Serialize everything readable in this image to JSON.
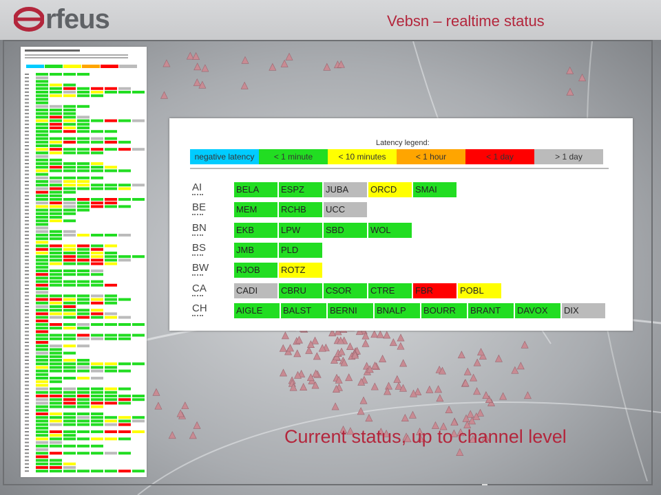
{
  "header": {
    "logo_text": "rfeus",
    "title": "Vebsn – realtime status"
  },
  "colors": {
    "negative": "#00ccff",
    "lt1min": "#22dd22",
    "lt10min": "#ffff00",
    "lt1hour": "#ffa500",
    "lt1day": "#ff0000",
    "gt1day": "#bbbbbb",
    "accent": "#b3263c",
    "marker": "#c88b93"
  },
  "legend": {
    "title": "Latency legend:",
    "items": [
      {
        "label": "negative latency",
        "status": "negative"
      },
      {
        "label": "< 1 minute",
        "status": "lt1min"
      },
      {
        "label": "< 10 minutes",
        "status": "lt10min"
      },
      {
        "label": "< 1 hour",
        "status": "lt1hour"
      },
      {
        "label": "< 1 day",
        "status": "lt1day"
      },
      {
        "label": "> 1 day",
        "status": "gt1day"
      }
    ]
  },
  "networks": [
    {
      "code": "AI",
      "stations": [
        {
          "name": "BELA",
          "status": "lt1min"
        },
        {
          "name": "ESPZ",
          "status": "lt1min"
        },
        {
          "name": "JUBA",
          "status": "gt1day"
        },
        {
          "name": "ORCD",
          "status": "lt10min"
        },
        {
          "name": "SMAI",
          "status": "lt1min"
        }
      ]
    },
    {
      "code": "BE",
      "stations": [
        {
          "name": "MEM",
          "status": "lt1min"
        },
        {
          "name": "RCHB",
          "status": "lt1min"
        },
        {
          "name": "UCC",
          "status": "gt1day"
        }
      ]
    },
    {
      "code": "BN",
      "stations": [
        {
          "name": "EKB",
          "status": "lt1min"
        },
        {
          "name": "LPW",
          "status": "lt1min"
        },
        {
          "name": "SBD",
          "status": "lt1min"
        },
        {
          "name": "WOL",
          "status": "lt1min"
        }
      ]
    },
    {
      "code": "BS",
      "stations": [
        {
          "name": "JMB",
          "status": "lt1min"
        },
        {
          "name": "PLD",
          "status": "lt1min"
        }
      ]
    },
    {
      "code": "BW",
      "stations": [
        {
          "name": "RJOB",
          "status": "lt1min"
        },
        {
          "name": "ROTZ",
          "status": "lt10min"
        }
      ]
    },
    {
      "code": "CA",
      "stations": [
        {
          "name": "CADI",
          "status": "gt1day"
        },
        {
          "name": "CBRU",
          "status": "lt1min"
        },
        {
          "name": "CSOR",
          "status": "lt1min"
        },
        {
          "name": "CTRE",
          "status": "lt1min"
        },
        {
          "name": "FBR",
          "status": "lt1day"
        },
        {
          "name": "POBL",
          "status": "lt10min"
        }
      ]
    },
    {
      "code": "CH",
      "stations": [
        {
          "name": "AIGLE",
          "status": "lt1min"
        },
        {
          "name": "BALST",
          "status": "lt1min"
        },
        {
          "name": "BERNI",
          "status": "lt1min"
        },
        {
          "name": "BNALP",
          "status": "lt1min"
        },
        {
          "name": "BOURR",
          "status": "lt1min"
        },
        {
          "name": "BRANT",
          "status": "lt1min"
        },
        {
          "name": "DAVOX",
          "status": "lt1min"
        },
        {
          "name": "DIX",
          "status": "gt1day"
        }
      ]
    }
  ],
  "caption": "Current status, up to channel level"
}
